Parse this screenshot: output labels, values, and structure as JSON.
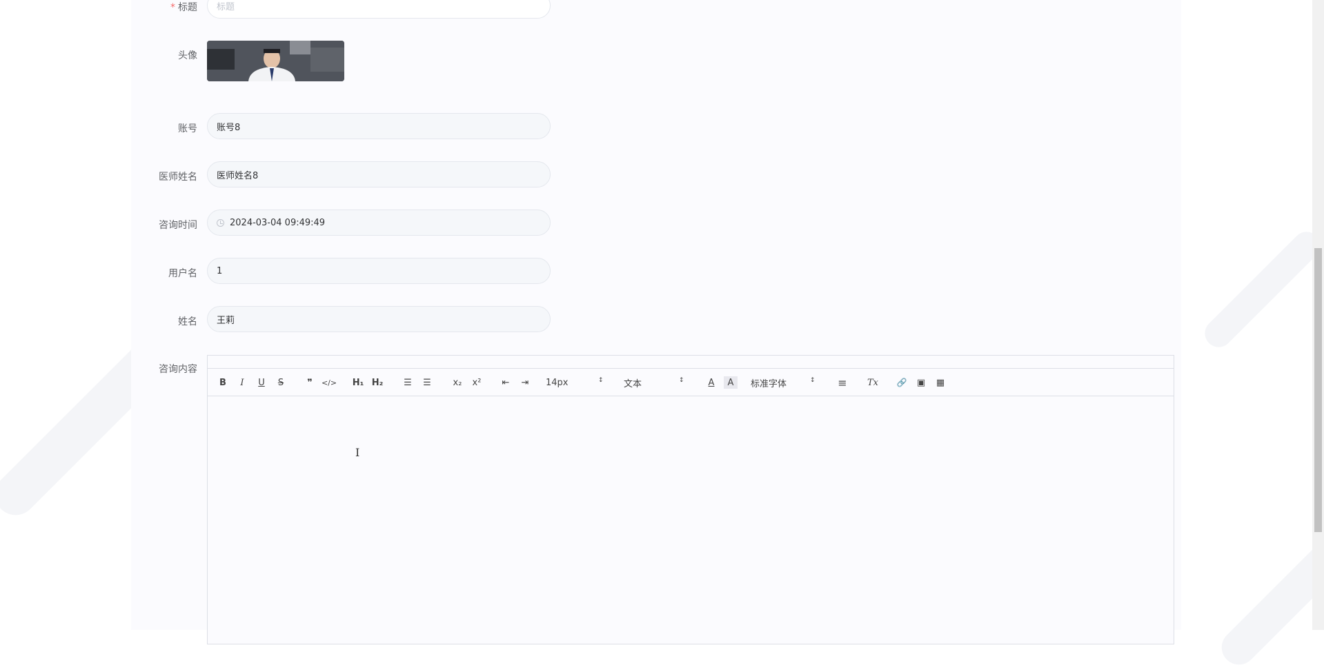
{
  "form": {
    "title_label": "标题",
    "title_placeholder": "标题",
    "avatar_label": "头像",
    "account_label": "账号",
    "account_value": "账号8",
    "doctor_label": "医师姓名",
    "doctor_value": "医师姓名8",
    "time_label": "咨询时间",
    "time_value": "2024-03-04 09:49:49",
    "username_label": "用户名",
    "username_value": "1",
    "name_label": "姓名",
    "name_value": "王莉",
    "content_label": "咨询内容"
  },
  "toolbar": {
    "bold": "B",
    "italic": "I",
    "underline": "U",
    "strike": "S",
    "quote": "❞",
    "code": "</>",
    "h1": "H₁",
    "h2": "H₂",
    "ordered_list": "☰",
    "bullet_list": "☰",
    "sub": "x₂",
    "sup": "x²",
    "outdent": "⇤",
    "indent": "⇥",
    "size": "14px",
    "header": "文本",
    "color": "A",
    "background": "A",
    "font": "标准字体",
    "align": "≡",
    "clean": "Tx",
    "link": "🔗",
    "image": "▣",
    "video": "▦"
  },
  "icons": {
    "clock": "clock-icon",
    "caret": "↕"
  }
}
